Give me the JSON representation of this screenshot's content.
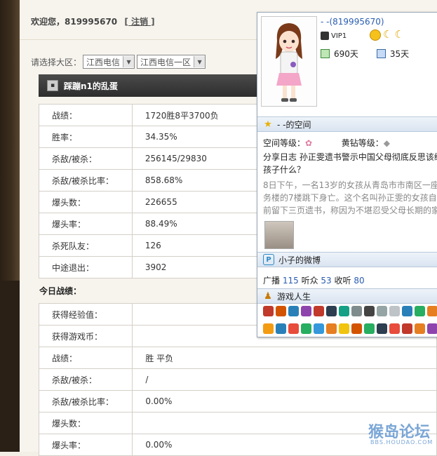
{
  "header": {
    "welcome": "欢迎您，819995670",
    "logout": "[ 注销 ]"
  },
  "region": {
    "label": "请选择大区：",
    "select1": "江西电信",
    "select2": "江西电信一区"
  },
  "player": {
    "name": "踩蹦n1的乱蛋"
  },
  "stats": [
    {
      "k": "战绩：",
      "v": "1720胜8平3700负"
    },
    {
      "k": "胜率：",
      "v": "34.35%"
    },
    {
      "k": "杀敌/被杀：",
      "v": "256145/29830"
    },
    {
      "k": "杀敌/被杀比率：",
      "v": "858.68%"
    },
    {
      "k": "爆头数：",
      "v": "226655"
    },
    {
      "k": "爆头率：",
      "v": "88.49%"
    },
    {
      "k": "杀死队友：",
      "v": "126"
    },
    {
      "k": "中途退出：",
      "v": "3902"
    }
  ],
  "today": {
    "title": "今日战绩：",
    "rows": [
      {
        "k": "获得经验值：",
        "v": ""
      },
      {
        "k": "获得游戏币：",
        "v": ""
      },
      {
        "k": "战绩：",
        "v": "胜 平负"
      },
      {
        "k": "杀敌/被杀：",
        "v": "/"
      },
      {
        "k": "杀敌/被杀比率：",
        "v": "0.00%"
      },
      {
        "k": "爆头数：",
        "v": ""
      },
      {
        "k": "爆头率：",
        "v": "0.00%"
      }
    ]
  },
  "popup": {
    "name": "- -(819995670)",
    "vip": "VIP1",
    "days1": "690天",
    "days2": "35天",
    "space_title": "- -的空间",
    "space_level": "空间等级：",
    "diamond_level": "黄钻等级：",
    "blog_line1": "分享日志 孙正雯遗书警示中国父母彻底反思该给",
    "blog_line2": "孩子什么？",
    "excerpt1": "8日下午，一名13岁的女孩从青岛市市南区一座商",
    "excerpt2": "务楼的7楼跳下身亡。这个名叫孙正雯的女孩自杀",
    "excerpt3": "前留下三页遗书，称因为不堪忍受父母长期的家",
    "weibo_title": "小子的微博",
    "broadcast_label": "广播",
    "broadcast_count": "115",
    "listen_label": "听众",
    "listen_count": "53",
    "follow_label": "收听",
    "follow_count": "80",
    "games_title": "游戏人生"
  },
  "watermark": {
    "main": "猴岛论坛",
    "sub": "BBS.HOUDAO.COM"
  },
  "colors": {
    "link": "#2a5db0",
    "namebar": "#3a3a3a",
    "border": "#d4d0c8"
  }
}
